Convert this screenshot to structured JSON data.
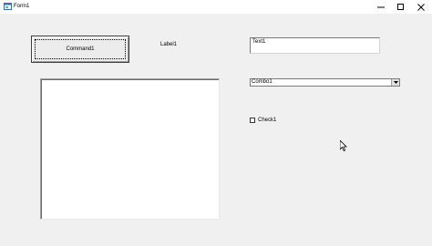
{
  "window": {
    "title": "Form1",
    "controls": [
      "minimize-icon",
      "maximize-icon",
      "close-icon"
    ]
  },
  "form": {
    "command_button": "Command1",
    "label": "Label1",
    "text_box": "Text1",
    "combo_box": "Combo1",
    "check_box": "Check1",
    "check_box_checked": false
  },
  "colors": {
    "form_background": "#f0f0f0",
    "titlebar_background": "#ffffff"
  }
}
